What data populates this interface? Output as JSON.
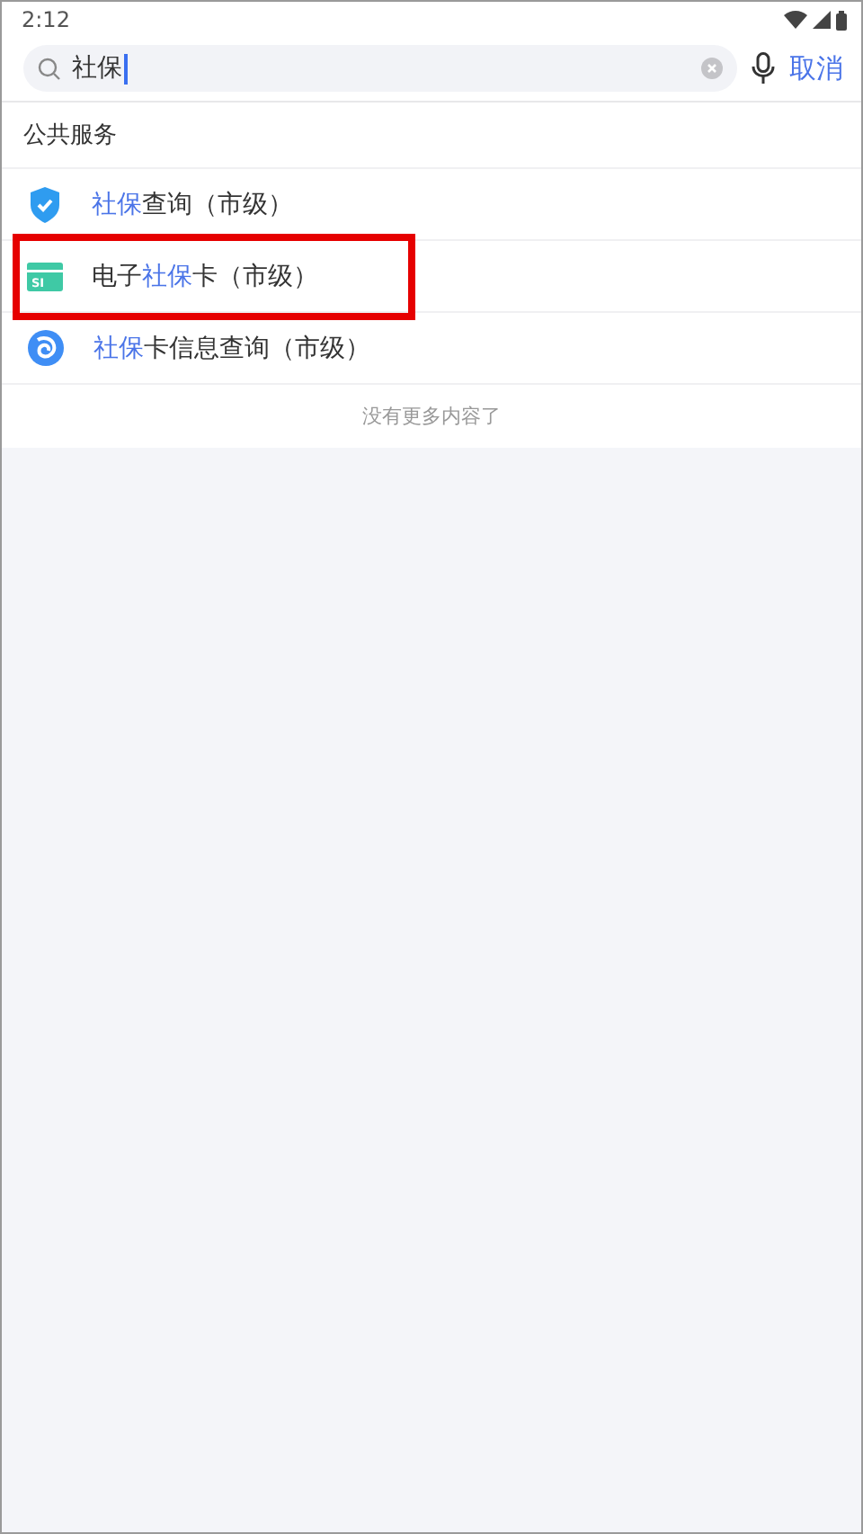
{
  "status_bar": {
    "time": "2:12"
  },
  "search": {
    "value": "社保",
    "cancel": "取消"
  },
  "section": {
    "title": "公共服务"
  },
  "results": [
    {
      "kind": "shield",
      "highlighted": false,
      "parts": [
        {
          "text": "社保",
          "match": true
        },
        {
          "text": "查询（市级）",
          "match": false
        }
      ]
    },
    {
      "kind": "card",
      "badge": "SI",
      "highlighted": true,
      "parts": [
        {
          "text": "电子",
          "match": false
        },
        {
          "text": "社保",
          "match": true
        },
        {
          "text": "卡（市级）",
          "match": false
        }
      ]
    },
    {
      "kind": "swirl",
      "highlighted": false,
      "parts": [
        {
          "text": "社保",
          "match": true
        },
        {
          "text": "卡信息查询（市级）",
          "match": false
        }
      ]
    }
  ],
  "footer": "没有更多内容了"
}
